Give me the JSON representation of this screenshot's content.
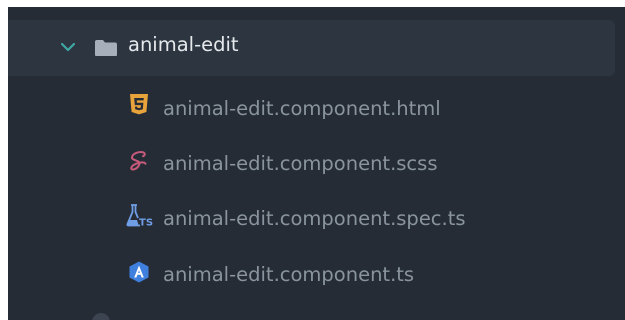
{
  "explorer": {
    "folder": {
      "name": "animal-edit",
      "expanded": true,
      "chevron_icon": "chevron-down-icon",
      "folder_icon": "folder-icon"
    },
    "files": [
      {
        "name": "animal-edit.component.html",
        "icon": "html5-icon",
        "icon_color": "#e8a33b"
      },
      {
        "name": "animal-edit.component.scss",
        "icon": "sass-icon",
        "icon_color": "#c7597b"
      },
      {
        "name": "animal-edit.component.spec.ts",
        "icon": "test-flask-ts-icon",
        "icon_color": "#6f9ee6"
      },
      {
        "name": "animal-edit.component.ts",
        "icon": "angular-icon",
        "icon_color": "#3f7fdd"
      }
    ]
  },
  "colors": {
    "background": "#252c36",
    "selected_row": "#2c3540",
    "folder_text": "#e6e9ec",
    "file_text": "#8a949e",
    "chevron": "#3fa7a1",
    "folder": "#a7b0ba"
  }
}
